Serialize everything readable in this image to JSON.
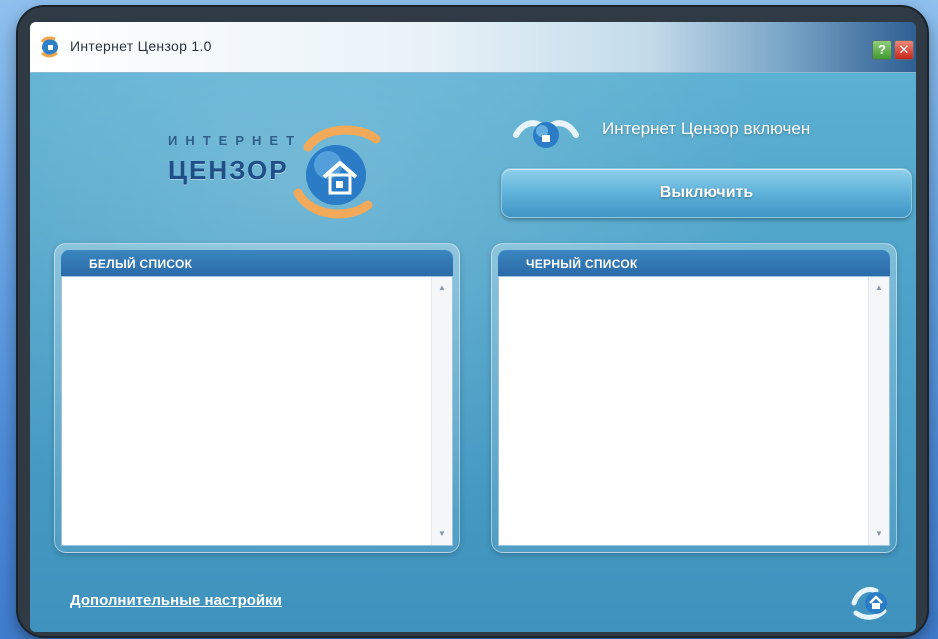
{
  "window": {
    "title": "Интернет Цензор 1.0",
    "help_label": "?",
    "close_label": "✕"
  },
  "logo": {
    "line1": "ИНТЕРНЕТ",
    "line2": "ЦЕНЗОР"
  },
  "status": {
    "text": "Интернет Цензор включен",
    "icon": "shield-globe-icon"
  },
  "toggle": {
    "label": "Выключить"
  },
  "whitelist": {
    "title": "БЕЛЫЙ СПИСОК",
    "items": []
  },
  "blacklist": {
    "title": "ЧЕРНЫЙ СПИСОК",
    "items": []
  },
  "footer": {
    "link": "Дополнительные настройки",
    "icon": "censor-logo-icon"
  },
  "colors": {
    "accent": "#2a6aa8",
    "background": "#4aa0c7",
    "help": "#3f9a2e",
    "close": "#c8261a"
  }
}
